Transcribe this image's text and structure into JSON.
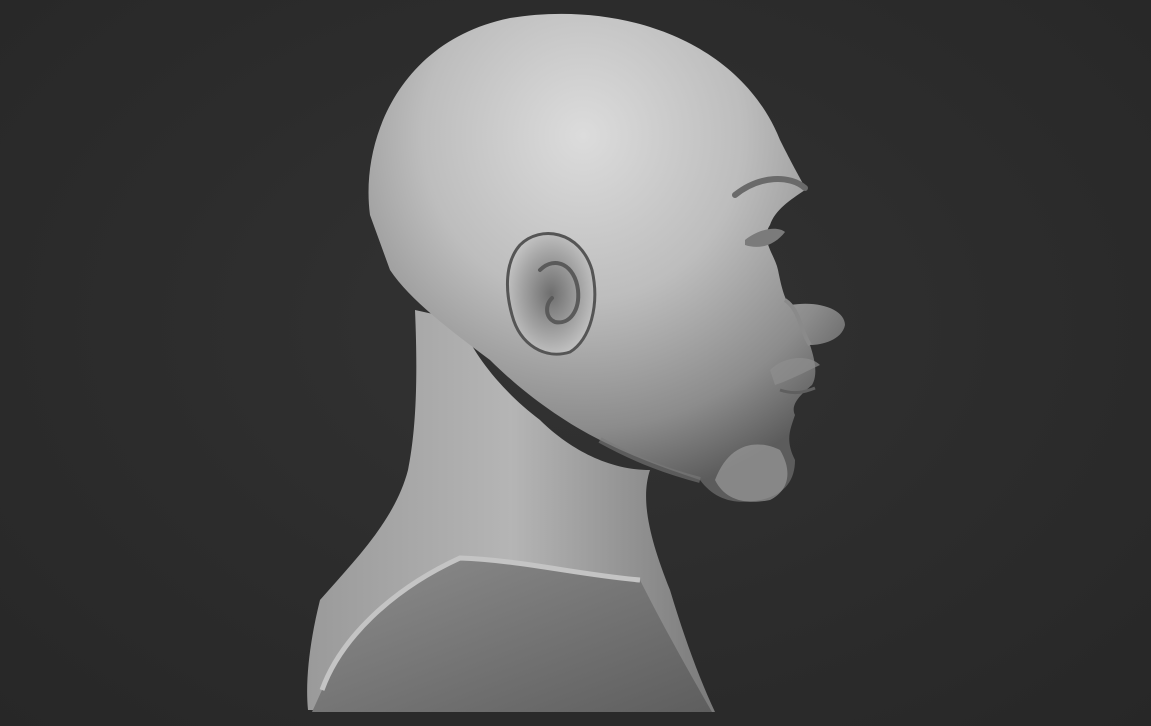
{
  "scene": {
    "subject": "sculpted-bust-profile",
    "material": "matte-clay",
    "colors": {
      "background": "#2b2b2b",
      "clay_light": "#d8d8d8",
      "clay_mid": "#a9a9a9",
      "clay_dark": "#555555"
    }
  }
}
